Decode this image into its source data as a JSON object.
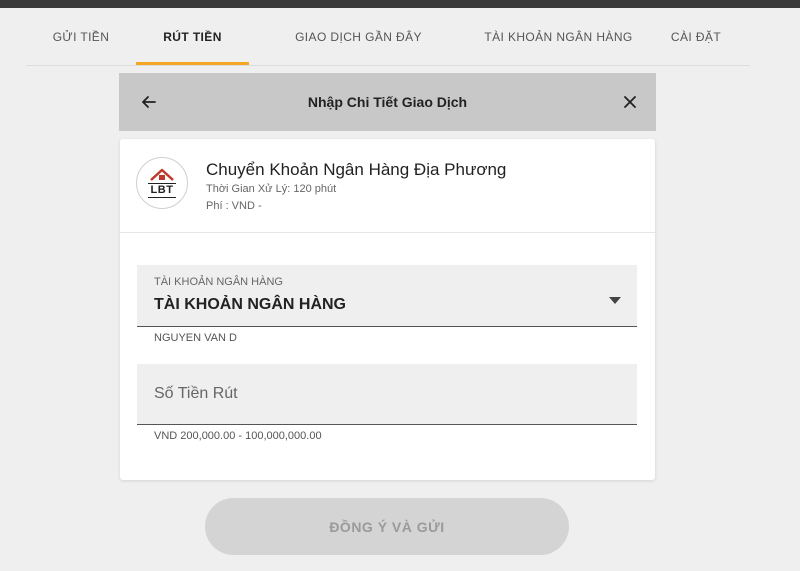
{
  "tabs": [
    {
      "label": "GỬI TIỀN"
    },
    {
      "label": "RÚT TIỀN",
      "active": true
    },
    {
      "label": "GIAO DỊCH GẦN ĐÂY"
    },
    {
      "label": "TÀI KHOẢN NGÂN HÀNG"
    },
    {
      "label": "CÀI ĐẶT"
    }
  ],
  "header": {
    "title": "Nhập Chi Tiết Giao Dịch",
    "back_icon": "arrow-left-icon",
    "close_icon": "close-icon"
  },
  "bank": {
    "logo_text": "LBT",
    "name": "Chuyển Khoản Ngân Hàng Địa Phương",
    "processing_time": "Thời Gian Xử Lý: 120 phút",
    "fee": "Phí : VND -"
  },
  "account_select": {
    "label": "TÀI KHOẢN NGÂN HÀNG",
    "value": "TÀI KHOẢN NGÂN HÀNG",
    "holder": "NGUYEN VAN D"
  },
  "amount": {
    "placeholder": "Số Tiền Rút",
    "value": "",
    "range": "VND 200,000.00 - 100,000,000.00"
  },
  "submit": {
    "label": "ĐỒNG Ý VÀ GỬI"
  },
  "colors": {
    "accent": "#f5a623",
    "header_bg": "#c8c8c8",
    "page_bg": "#efefef",
    "button_disabled_bg": "#d4d4d4"
  }
}
